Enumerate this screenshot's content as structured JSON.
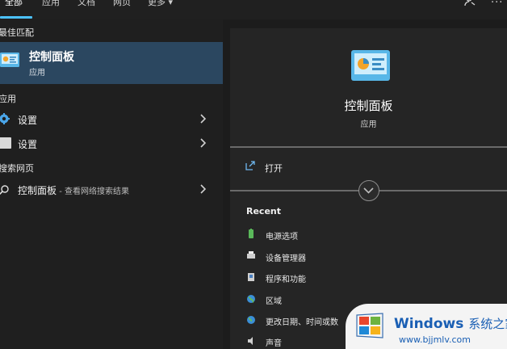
{
  "tabs": [
    {
      "label": "全部",
      "active": true
    },
    {
      "label": "应用"
    },
    {
      "label": "文档"
    },
    {
      "label": "网页"
    },
    {
      "label": "更多 ▾"
    }
  ],
  "top_icons": [
    "account-icon",
    "more-options-icon"
  ],
  "left": {
    "best_match_header": "最佳匹配",
    "best_match": {
      "title": "控制面板",
      "subtitle": "应用",
      "icon": "control-panel-icon"
    },
    "apps_header": "应用",
    "apps": [
      {
        "label": "设置",
        "icon": "gear-icon"
      },
      {
        "label": "设置",
        "icon": "settings-tile-icon"
      }
    ],
    "web_header": "搜索网页",
    "web": {
      "label": "控制面板",
      "suffix": " - 查看网络搜索结果",
      "icon": "search-icon"
    }
  },
  "right": {
    "title": "控制面板",
    "subtitle": "应用",
    "open_label": "打开",
    "recent_header": "Recent",
    "recent": [
      {
        "label": "电源选项",
        "icon": "battery-icon"
      },
      {
        "label": "设备管理器",
        "icon": "printer-icon"
      },
      {
        "label": "程序和功能",
        "icon": "programs-icon"
      },
      {
        "label": "区域",
        "icon": "globe-icon"
      },
      {
        "label": "更改日期、时间或数",
        "icon": "globe-clock-icon"
      },
      {
        "label": "声音",
        "icon": "speaker-icon"
      }
    ]
  },
  "watermark": {
    "brand": "Windows",
    "brand_suffix": "系统之家",
    "url": "www.bjjmlv.com"
  },
  "colors": {
    "accent": "#4cc2ff",
    "selected_row": "#2b4760",
    "pane_bg": "#252525"
  }
}
